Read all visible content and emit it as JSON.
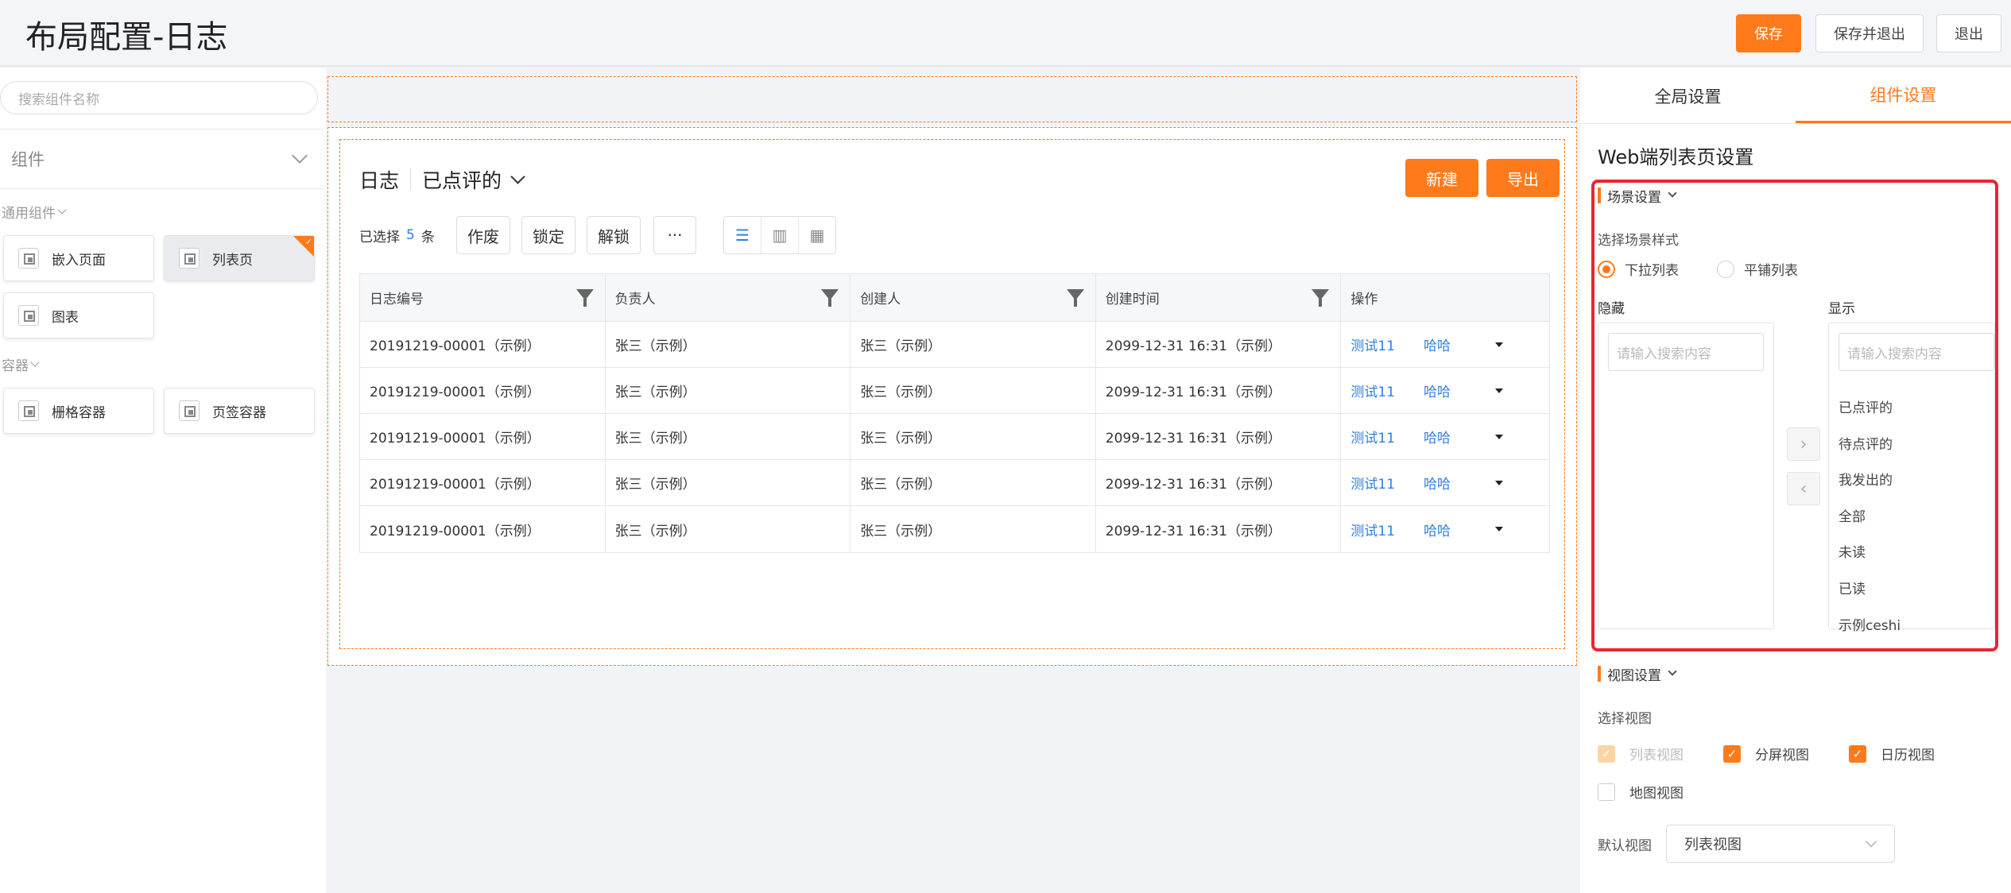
{
  "header": {
    "title": "布局配置-日志",
    "save_label": "保存",
    "save_exit_label": "保存并退出",
    "exit_label": "退出"
  },
  "sidebar": {
    "search_placeholder": "搜索组件名称",
    "component_select": "组件",
    "general_group": "通用组件",
    "container_group": "容器",
    "general_items": [
      "嵌入页面",
      "列表页",
      "图表"
    ],
    "container_items": [
      "栅格容器",
      "页签容器"
    ]
  },
  "canvas": {
    "view_name": "日志",
    "view_filter": "已点评的",
    "new_label": "新建",
    "export_label": "导出",
    "selected_prefix": "已选择",
    "selected_count": "5",
    "selected_suffix": "条",
    "actions": [
      "作废",
      "锁定",
      "解锁",
      "···"
    ],
    "columns": [
      "日志编号",
      "负责人",
      "创建人",
      "创建时间",
      "操作"
    ],
    "rows": [
      [
        "20191219-00001（示例）",
        "张三（示例）",
        "张三（示例）",
        "2099-12-31 16:31（示例）",
        "测试11",
        "哈哈"
      ],
      [
        "20191219-00001（示例）",
        "张三（示例）",
        "张三（示例）",
        "2099-12-31 16:31（示例）",
        "测试11",
        "哈哈"
      ],
      [
        "20191219-00001（示例）",
        "张三（示例）",
        "张三（示例）",
        "2099-12-31 16:31（示例）",
        "测试11",
        "哈哈"
      ],
      [
        "20191219-00001（示例）",
        "张三（示例）",
        "张三（示例）",
        "2099-12-31 16:31（示例）",
        "测试11",
        "哈哈"
      ],
      [
        "20191219-00001（示例）",
        "张三（示例）",
        "张三（示例）",
        "2099-12-31 16:31（示例）",
        "测试11",
        "哈哈"
      ]
    ]
  },
  "panel": {
    "tab_global": "全局设置",
    "tab_component": "组件设置",
    "title": "Web端列表页设置",
    "scene_section": "场景设置",
    "scene_style_label": "选择场景样式",
    "scene_options": [
      "下拉列表",
      "平铺列表"
    ],
    "hidden_label": "隐藏",
    "shown_label": "显示",
    "search_placeholder": "请输入搜索内容",
    "shown_items": [
      "已点评的",
      "待点评的",
      "我发出的",
      "全部",
      "未读",
      "已读",
      "示例ceshi"
    ],
    "view_section": "视图设置",
    "view_choose_label": "选择视图",
    "view_options": [
      "列表视图",
      "分屏视图",
      "日历视图",
      "地图视图"
    ],
    "default_view_label": "默认视图",
    "default_view_value": "列表视图"
  },
  "colors": {
    "accent": "#ff7a1a",
    "link": "#2f7fe0",
    "highlight": "#e8262f"
  }
}
